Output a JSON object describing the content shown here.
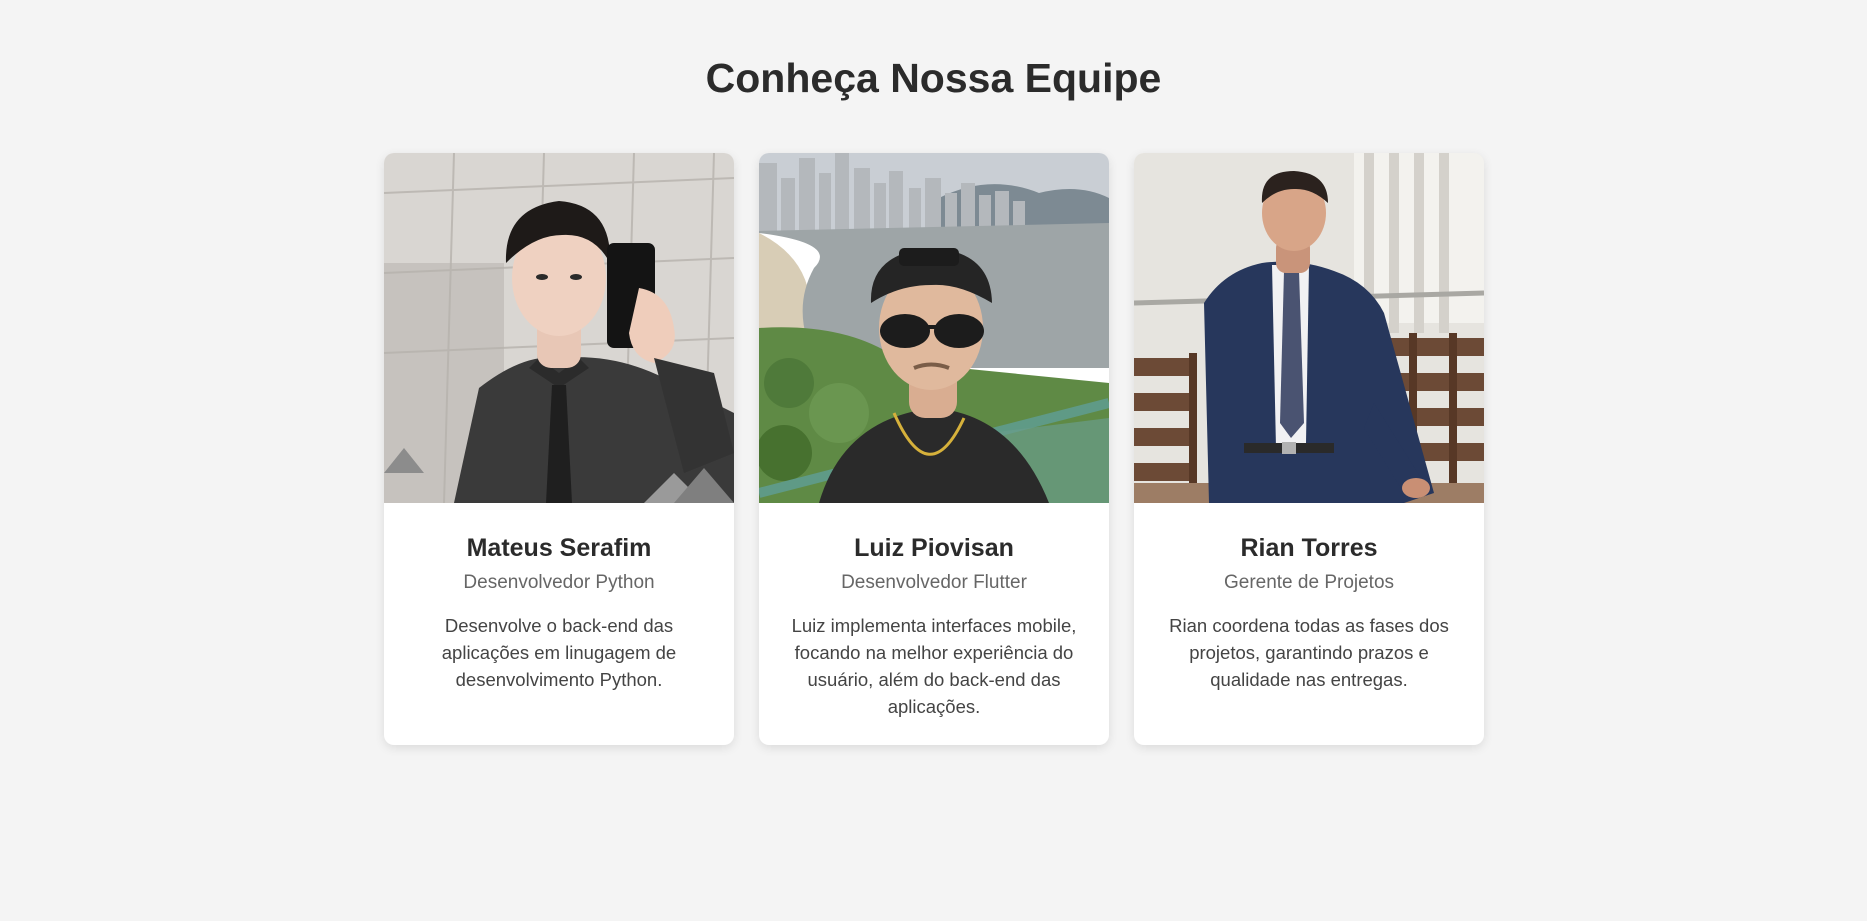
{
  "page": {
    "title": "Conheça Nossa Equipe",
    "background": "#f4f4f4"
  },
  "team": [
    {
      "name": "Mateus Serafim",
      "role": "Desenvolvedor Python",
      "description": "Desenvolve o back-end das aplicações em linugagem de desenvolvimento Python.",
      "photo_icon": "portrait-photo"
    },
    {
      "name": "Luiz Piovisan",
      "role": "Desenvolvedor Flutter",
      "description": "Luiz implementa interfaces mobile, focando na melhor experiência do usuário, além do back-end das aplicações.",
      "photo_icon": "portrait-photo"
    },
    {
      "name": "Rian Torres",
      "role": "Gerente de Projetos",
      "description": "Rian coordena todas as fases dos projetos, garantindo prazos e qualidade nas entregas.",
      "photo_icon": "portrait-photo"
    }
  ],
  "colors": {
    "card_background": "#ffffff",
    "title_text": "#2b2b2b",
    "role_text": "#666666",
    "description_text": "#444444"
  }
}
